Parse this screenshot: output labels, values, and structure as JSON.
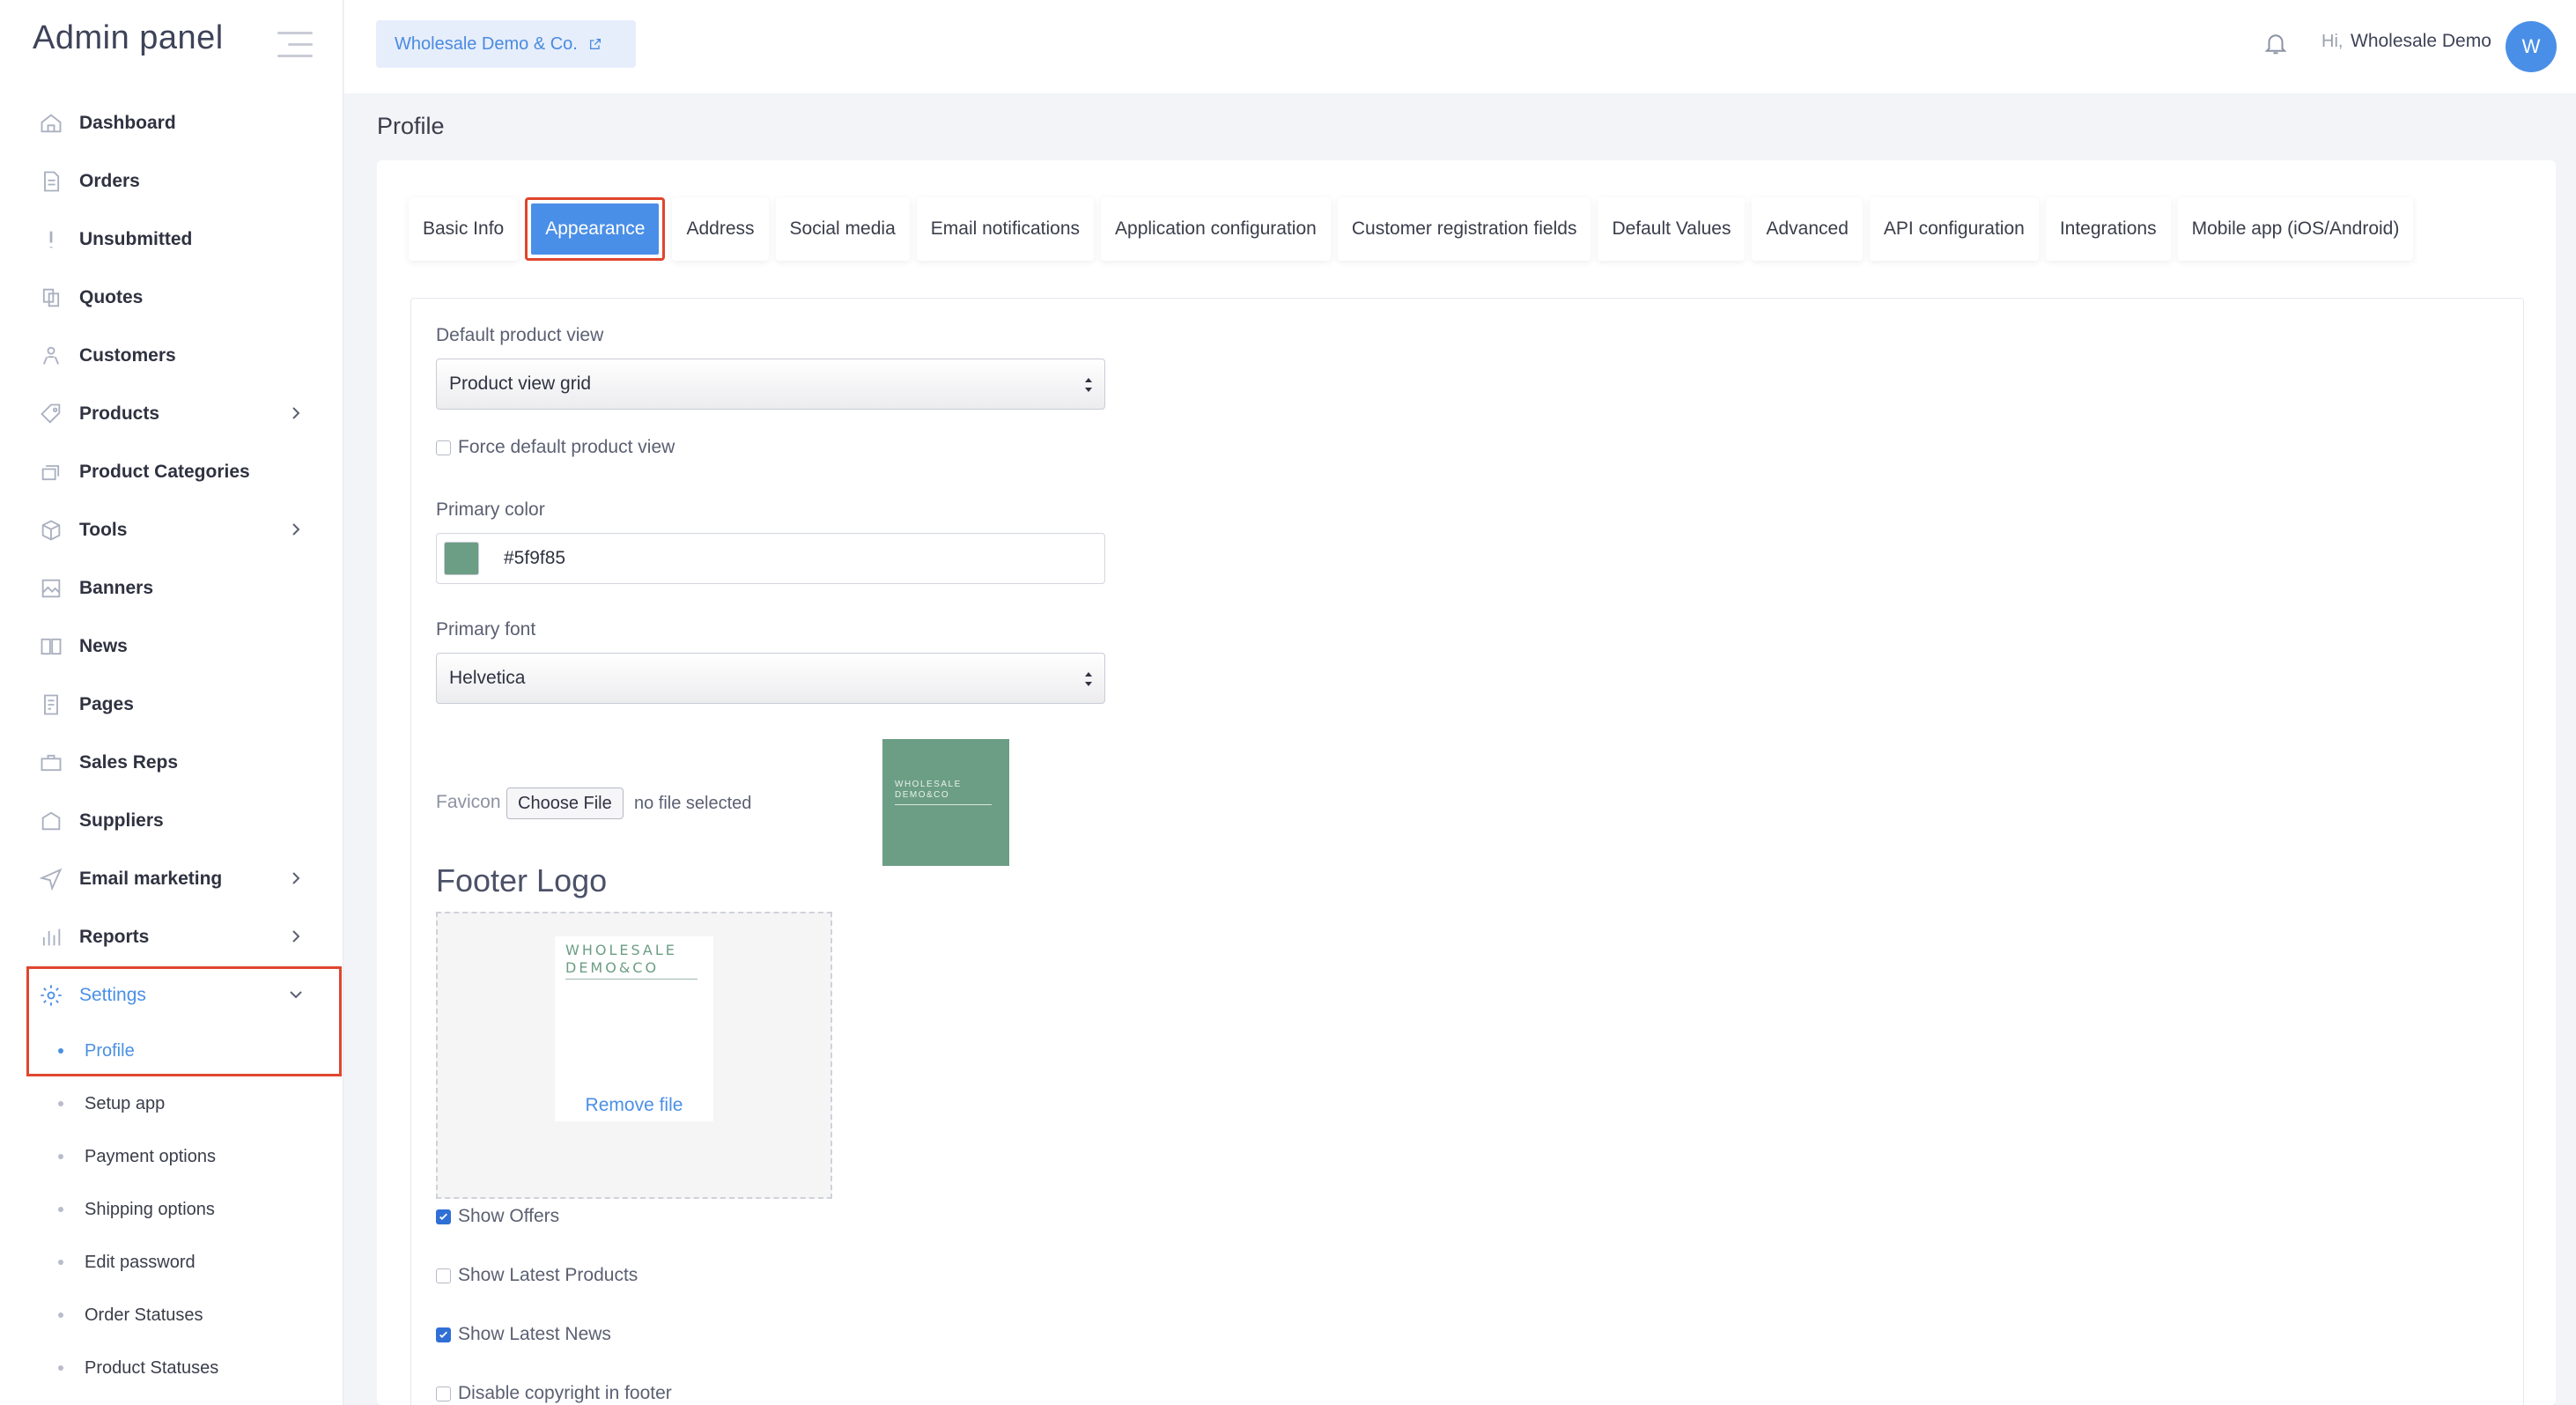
{
  "sidebar": {
    "brand": "Admin panel",
    "items": [
      {
        "label": "Dashboard",
        "icon": "home-icon"
      },
      {
        "label": "Orders",
        "icon": "document-icon"
      },
      {
        "label": "Unsubmitted",
        "icon": "exclamation-icon"
      },
      {
        "label": "Quotes",
        "icon": "copy-icon"
      },
      {
        "label": "Customers",
        "icon": "users-icon"
      },
      {
        "label": "Products",
        "icon": "tag-icon"
      },
      {
        "label": "Product Categories",
        "icon": "layers-icon"
      },
      {
        "label": "Tools",
        "icon": "box-icon"
      },
      {
        "label": "Banners",
        "icon": "image-icon"
      },
      {
        "label": "News",
        "icon": "book-icon"
      },
      {
        "label": "Pages",
        "icon": "page-icon"
      },
      {
        "label": "Sales Reps",
        "icon": "briefcase-icon"
      },
      {
        "label": "Suppliers",
        "icon": "building-icon"
      },
      {
        "label": "Email marketing",
        "icon": "send-icon"
      },
      {
        "label": "Reports",
        "icon": "bar-chart-icon"
      },
      {
        "label": "Settings",
        "icon": "gear-icon"
      }
    ],
    "settings_sub": [
      {
        "label": "Profile"
      },
      {
        "label": "Setup app"
      },
      {
        "label": "Payment options"
      },
      {
        "label": "Shipping options"
      },
      {
        "label": "Edit password"
      },
      {
        "label": "Order Statuses"
      },
      {
        "label": "Product Statuses"
      }
    ]
  },
  "header": {
    "store_name": "Wholesale Demo & Co.",
    "greeting": "Hi,",
    "user_name": "Wholesale Demo",
    "avatar_initial": "W"
  },
  "page": {
    "title": "Profile"
  },
  "tabs": [
    {
      "label": "Basic Info"
    },
    {
      "label": "Appearance"
    },
    {
      "label": "Address"
    },
    {
      "label": "Social media"
    },
    {
      "label": "Email notifications"
    },
    {
      "label": "Application configuration"
    },
    {
      "label": "Customer registration fields"
    },
    {
      "label": "Default Values"
    },
    {
      "label": "Advanced"
    },
    {
      "label": "API configuration"
    },
    {
      "label": "Integrations"
    },
    {
      "label": "Mobile app (iOS/Android)"
    }
  ],
  "form": {
    "default_view_label": "Default product view",
    "default_view_value": "Product view grid",
    "force_default_label": "Force default product view",
    "force_default_checked": false,
    "primary_color_label": "Primary color",
    "primary_color_value": "#5f9f85",
    "primary_font_label": "Primary font",
    "primary_font_value": "Helvetica",
    "favicon_label": "Favicon",
    "choose_file": "Choose File",
    "no_file": "no file selected",
    "footer_logo_heading": "Footer Logo",
    "logo_text_line1": "WHOLESALE",
    "logo_text_line2": "DEMO&CO",
    "remove_file": "Remove file",
    "show_offers_label": "Show Offers",
    "show_offers_checked": true,
    "show_latest_products_label": "Show Latest Products",
    "show_latest_products_checked": false,
    "show_latest_news_label": "Show Latest News",
    "show_latest_news_checked": true,
    "disable_copyright_label": "Disable copyright in footer",
    "disable_copyright_checked": false
  },
  "colors": {
    "accent": "#4a8fe7",
    "highlight": "#e0452e",
    "brand_green": "#6c9e85"
  }
}
